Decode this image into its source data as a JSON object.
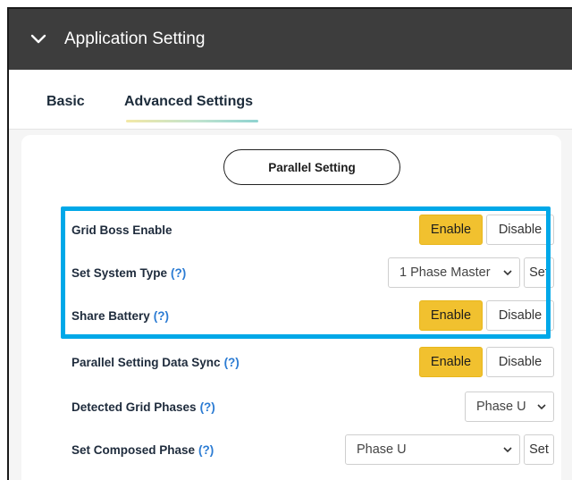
{
  "header": {
    "title": "Application Setting"
  },
  "tabs": [
    {
      "label": "Basic"
    },
    {
      "label": "Advanced Settings"
    }
  ],
  "section_button": "Parallel Setting",
  "rows": [
    {
      "label": "Grid Boss Enable",
      "help": "",
      "enable": "Enable",
      "disable": "Disable"
    },
    {
      "label": "Set System Type",
      "help": "(?)",
      "select": "1 Phase Master",
      "set": "Set"
    },
    {
      "label": "Share Battery",
      "help": "(?)",
      "enable": "Enable",
      "disable": "Disable"
    },
    {
      "label": "Parallel Setting Data Sync",
      "help": "(?)",
      "enable": "Enable",
      "disable": "Disable"
    },
    {
      "label": "Detected Grid Phases",
      "help": "(?)",
      "select": "Phase U"
    },
    {
      "label": "Set Composed Phase",
      "help": "(?)",
      "select": "Phase U",
      "set": "Set"
    }
  ],
  "colors": {
    "header_bg": "#3d3d3d",
    "enable_bg": "#f1c12f",
    "highlight_border": "#00a8e8",
    "help_link": "#2b7bd3"
  },
  "icons": {
    "header_toggle": "chevron-down-icon",
    "select_caret": "chevron-down-icon"
  }
}
